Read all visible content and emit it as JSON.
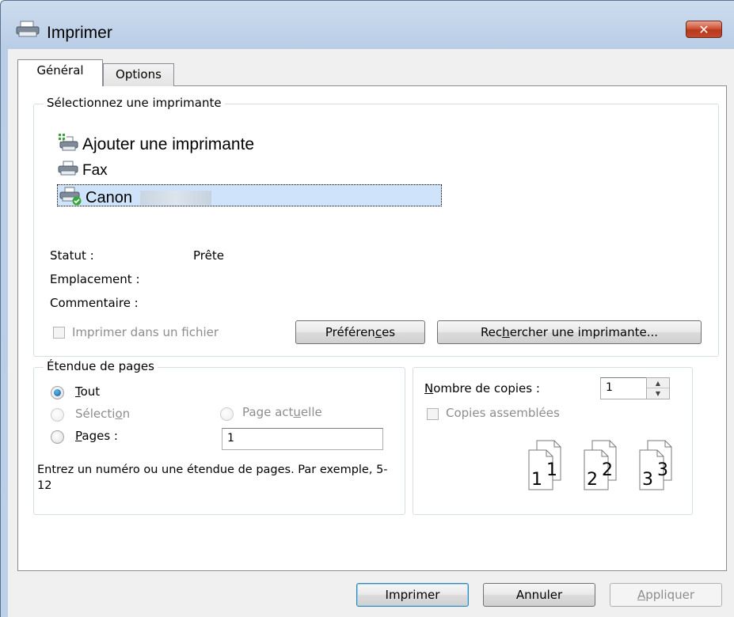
{
  "window": {
    "title": "Imprimer",
    "close_label": "✕"
  },
  "tabs": [
    {
      "label": "Général",
      "active": true
    },
    {
      "label": "Options",
      "active": false
    }
  ],
  "printer_group": {
    "label": "Sélectionnez une imprimante",
    "printers": [
      {
        "label": "Ajouter une imprimante",
        "icon": "add-printer-icon"
      },
      {
        "label": "Fax",
        "icon": "fax-printer-icon"
      },
      {
        "label": "Canon",
        "icon": "default-printer-icon",
        "selected": true
      }
    ],
    "status_label": "Statut :",
    "status_value": "Prête",
    "location_label": "Emplacement :",
    "location_value": "",
    "comment_label": "Commentaire :",
    "comment_value": "",
    "print_to_file_label": "Imprimer dans un fichier",
    "preferences_label_before": "Préféren",
    "preferences_label_accel": "c",
    "preferences_label_after": "es",
    "find_printer_label_before": "Rec",
    "find_printer_label_accel": "h",
    "find_printer_label_after": "ercher une imprimante..."
  },
  "page_range": {
    "label": "Étendue de pages",
    "all_accel": "T",
    "all_rest": "out",
    "selection_before": "Sélecti",
    "selection_accel": "o",
    "selection_after": "n",
    "current_page_before": "Page act",
    "current_page_accel": "u",
    "current_page_after": "elle",
    "pages_accel": "P",
    "pages_rest": "ages :",
    "pages_value": "1",
    "hint": "Entrez un numéro ou une étendue de pages. Par exemple, 5-12"
  },
  "copies": {
    "count_accel": "N",
    "count_rest": "ombre de copies :",
    "count_value": "1",
    "collate_label": "Copies assemblées",
    "collate_pages": [
      "1",
      "1",
      "2",
      "2",
      "3",
      "3"
    ]
  },
  "footer": {
    "print_label": "Imprimer",
    "cancel_label": "Annuler",
    "apply_accel": "A",
    "apply_rest": "ppliquer"
  },
  "colors": {
    "selection": "#cfe4fa",
    "accent": "#3c7fb1",
    "close": "#c2492c"
  }
}
